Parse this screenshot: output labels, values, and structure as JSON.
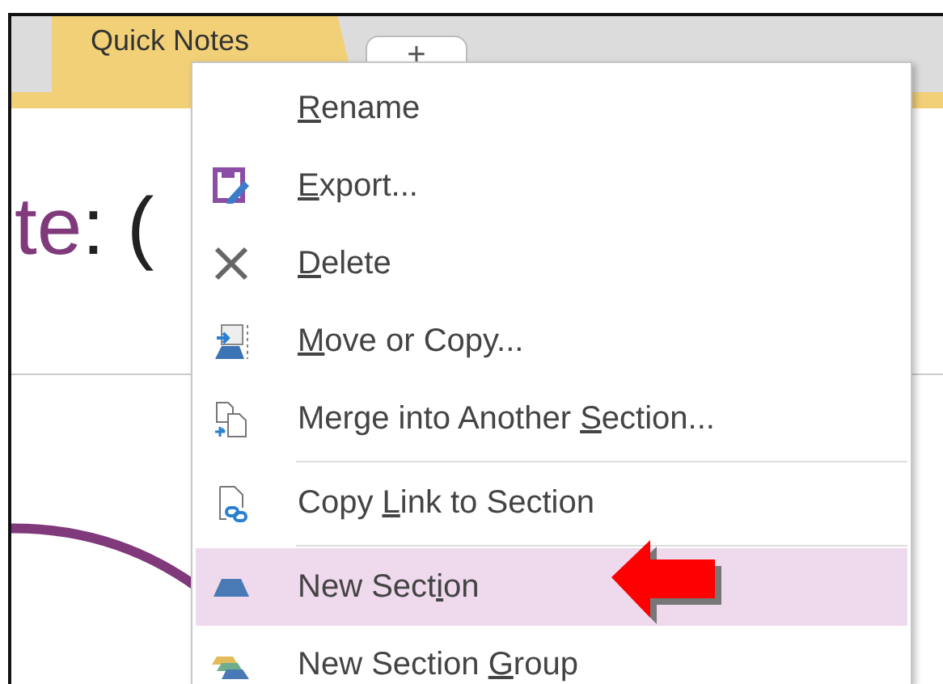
{
  "tabs": [
    {
      "label": "Quick Notes",
      "kind": "section",
      "selected": true
    },
    {
      "label": "+",
      "kind": "add",
      "selected": false
    }
  ],
  "page": {
    "title_segments": [
      {
        "text": "te",
        "color": "#80397b"
      },
      {
        "text": ": (",
        "color": "#222222"
      }
    ]
  },
  "context_menu": {
    "items": [
      {
        "kind": "none",
        "access_key": "R",
        "text_after": "ename",
        "selected": false
      },
      {
        "kind": "export",
        "access_key": "E",
        "text_after": "xport...",
        "selected": false
      },
      {
        "kind": "delete",
        "access_key": "D",
        "text_after": "elete",
        "selected": false
      },
      {
        "kind": "move",
        "access_key": "M",
        "text_after": "ove or Copy...",
        "selected": false
      },
      {
        "kind": "merge",
        "text_before": "Merge into Another ",
        "access_key": "S",
        "text_after": "ection...",
        "selected": false
      },
      {
        "kind": "separator"
      },
      {
        "kind": "link",
        "text_before": "Copy ",
        "access_key": "L",
        "text_after": "ink to Section",
        "selected": false
      },
      {
        "kind": "separator"
      },
      {
        "kind": "new-section",
        "text_before": "New Sect",
        "access_key": "i",
        "text_after": "on",
        "selected": true
      },
      {
        "kind": "new-group",
        "text_before": "New Section ",
        "access_key": "G",
        "text_after": "roup",
        "selected": false
      }
    ]
  }
}
